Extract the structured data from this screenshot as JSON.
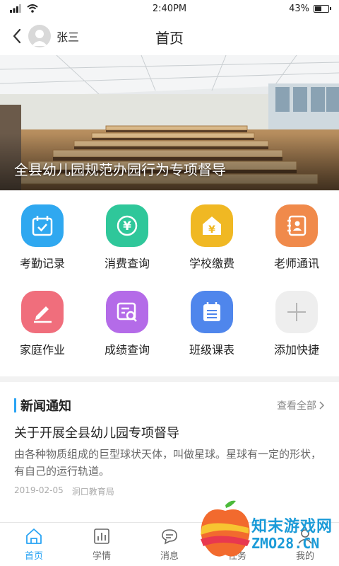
{
  "status_bar": {
    "time": "2:40PM",
    "battery_level": "43%"
  },
  "header": {
    "user_name": "张三",
    "title": "首页"
  },
  "banner": {
    "caption": "全县幼儿园规范办园行为专项督导"
  },
  "shortcuts": [
    {
      "label": "考勤记录",
      "icon": "calendar-check-icon",
      "color": "#2fa8f0"
    },
    {
      "label": "消费查询",
      "icon": "yuan-coin-icon",
      "color": "#2fc79a"
    },
    {
      "label": "学校缴费",
      "icon": "school-yuan-icon",
      "color": "#f0b823"
    },
    {
      "label": "老师通讯",
      "icon": "contact-book-icon",
      "color": "#f08a4b"
    },
    {
      "label": "家庭作业",
      "icon": "pencil-icon",
      "color": "#f06e7c"
    },
    {
      "label": "成绩查询",
      "icon": "report-search-icon",
      "color": "#b46be8"
    },
    {
      "label": "班级课表",
      "icon": "timetable-icon",
      "color": "#4f86ec"
    },
    {
      "label": "添加快捷",
      "icon": "plus-icon",
      "color": "#eeeeee"
    }
  ],
  "news": {
    "section_title": "新闻通知",
    "view_all": "查看全部",
    "article": {
      "title": "关于开展全县幼儿园专项督导",
      "description": "由各种物质组成的巨型球状天体，叫做星球。星球有一定的形状，有自己的运行轨道。",
      "date": "2019-02-05",
      "source": "洞口教育局"
    }
  },
  "tabbar": {
    "tabs": [
      {
        "label": "首页",
        "icon": "home-icon",
        "active": true
      },
      {
        "label": "学情",
        "icon": "bar-chart-icon",
        "active": false
      },
      {
        "label": "消息",
        "icon": "chat-bubble-icon",
        "active": false
      },
      {
        "label": "任务",
        "icon": "task-icon",
        "active": false
      },
      {
        "label": "我的",
        "icon": "person-icon",
        "active": false
      }
    ]
  },
  "watermark": {
    "line1": "知末游戏网",
    "line2": "ZMO28.CN"
  }
}
